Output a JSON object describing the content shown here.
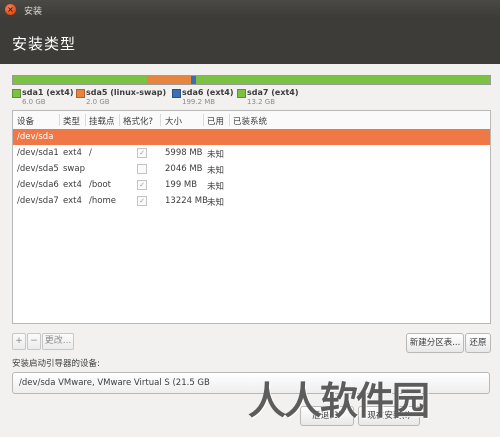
{
  "window": {
    "title": "安装"
  },
  "header": {
    "title": "安装类型"
  },
  "partitions_bar": {
    "segments": [
      {
        "name": "sda1",
        "color": "#7cc242",
        "size_gb": 6.0
      },
      {
        "name": "sda5",
        "color": "#e7843d",
        "size_gb": 2.0
      },
      {
        "name": "sda6",
        "color": "#3a6fb0",
        "size_gb": 0.1992
      },
      {
        "name": "sda7",
        "color": "#7cc242",
        "size_gb": 13.2
      }
    ]
  },
  "legend": [
    {
      "name": "sda1 (ext4)",
      "size": "6.0 GB",
      "color": "#7cc242"
    },
    {
      "name": "sda5 (linux-swap)",
      "size": "2.0 GB",
      "color": "#e7843d"
    },
    {
      "name": "sda6 (ext4)",
      "size": "199.2 MB",
      "color": "#3a6fb0"
    },
    {
      "name": "sda7 (ext4)",
      "size": "13.2 GB",
      "color": "#7cc242"
    }
  ],
  "table": {
    "columns": [
      "设备",
      "类型",
      "挂载点",
      "格式化?",
      "大小",
      "已用",
      "已装系统"
    ],
    "device_row": "/dev/sda",
    "rows": [
      {
        "device": "/dev/sda1",
        "type": "ext4",
        "mount": "/",
        "format": true,
        "size": "5998 MB",
        "used": "未知"
      },
      {
        "device": "/dev/sda5",
        "type": "swap",
        "mount": "",
        "format": false,
        "size": "2046 MB",
        "used": "未知"
      },
      {
        "device": "/dev/sda6",
        "type": "ext4",
        "mount": "/boot",
        "format": true,
        "size": "199 MB",
        "used": "未知"
      },
      {
        "device": "/dev/sda7",
        "type": "ext4",
        "mount": "/home",
        "format": true,
        "size": "13224 MB",
        "used": "未知"
      }
    ]
  },
  "toolbar": {
    "add": "+",
    "remove": "−",
    "change": "更改..."
  },
  "buttons": {
    "new_table": "新建分区表...",
    "revert": "还原"
  },
  "boot": {
    "label": "安装启动引导器的设备:",
    "value": "/dev/sda   VMware, VMware Virtual S (21.5 GB"
  },
  "footer": {
    "back": "后退(B)",
    "install": "现在安装(I)"
  },
  "watermark": "人人软件园",
  "icons": {
    "close": "close-icon",
    "check": "checkmark-icon"
  }
}
